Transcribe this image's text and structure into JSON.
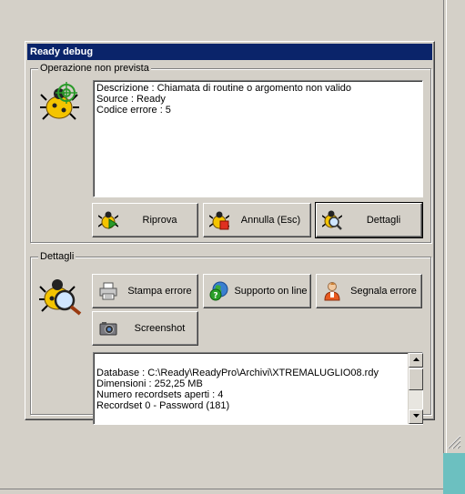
{
  "window": {
    "title": "Ready debug"
  },
  "group_error": {
    "label": "Operazione non prevista",
    "icon": "bug-target-icon",
    "lines": [
      "Descrizione : Chiamata di routine o argomento non valido",
      "Source : Ready",
      "Codice errore : 5"
    ]
  },
  "buttons": {
    "retry": {
      "label": "Riprova",
      "icon": "bug-play-icon"
    },
    "cancel": {
      "label": "Annulla (Esc)",
      "icon": "bug-stop-icon"
    },
    "details": {
      "label": "Dettagli",
      "icon": "bug-magnifier-icon"
    },
    "print": {
      "label": "Stampa errore",
      "icon": "printer-icon"
    },
    "support": {
      "label": "Supporto on line",
      "icon": "globe-help-icon"
    },
    "report": {
      "label": "Segnala errore",
      "icon": "person-icon"
    },
    "screenshot": {
      "label": "Screenshot",
      "icon": "camera-icon"
    }
  },
  "group_details": {
    "label": "Dettagli",
    "icon": "bug-magnifier-icon",
    "lines": [
      "Database : C:\\Ready\\ReadyPro\\Archivi\\XTREMALUGLIO08.rdy",
      "Dimensioni : 252,25 MB",
      "Numero recordsets aperti : 4",
      "Recordset 0 - Password (181)"
    ]
  },
  "colors": {
    "titlebar": "#0a246a",
    "face": "#d4d0c8",
    "desktop_accent": "#6cc0c0"
  }
}
